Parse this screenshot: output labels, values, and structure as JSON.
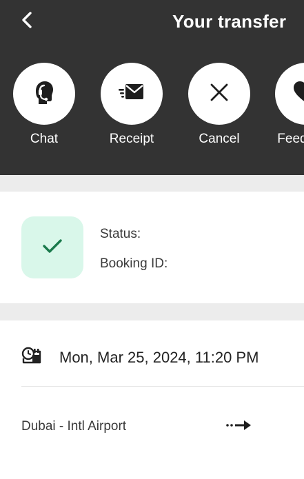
{
  "header": {
    "title": "Your transfer",
    "back_icon": "chevron-left-icon",
    "background_color": "#333333"
  },
  "actions": [
    {
      "label": "Chat",
      "icon": "headset-icon"
    },
    {
      "label": "Receipt",
      "icon": "envelope-fast-icon"
    },
    {
      "label": "Cancel",
      "icon": "close-icon"
    },
    {
      "label": "Feedback",
      "icon": "heart-icon"
    }
  ],
  "booking": {
    "status_icon": "checkmark-icon",
    "status_color": "#1a7a4c",
    "status_bg_color": "#d9f7ea",
    "status_label": "Status:",
    "booking_id_label": "Booking ID:"
  },
  "trip": {
    "datetime": "Mon, Mar 25, 2024, 11:20 PM",
    "datetime_icon": "clock-calendar-icon",
    "origin": "Dubai - Intl Airport",
    "route_icon": "dotted-arrow-right-icon"
  }
}
